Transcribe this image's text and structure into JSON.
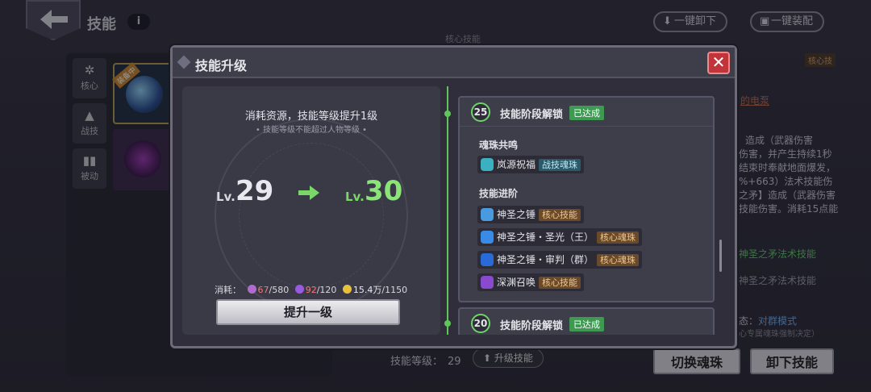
{
  "background": {
    "page_title": "技能",
    "info_label": "i",
    "top_buttons": [
      {
        "icon": "download-icon",
        "label": "一键卸下"
      },
      {
        "icon": "equip-icon",
        "label": "一键装配"
      }
    ],
    "tabs": [
      {
        "icon": "core-icon",
        "label": "核心"
      },
      {
        "icon": "combat-icon",
        "label": "战技"
      },
      {
        "icon": "passive-icon",
        "label": "被动"
      }
    ],
    "slot_badge": "装备中",
    "header_text": "核心技能",
    "core_tag": "核心技",
    "skill_link": "的电泵",
    "desc_lines": [
      "造成（武器伤害",
      "伤害，并产生持续1秒",
      "结束时奉献地面爆发，",
      "%+663）法术技能伤",
      "之矛】造成（武器伤害",
      "技能伤害。消耗15点能"
    ],
    "green_text": "神圣之矛法术技能",
    "gray_text": "神圣之矛法术技能",
    "mode_prefix": "态：",
    "mode_value": "对群模式",
    "mode_note": "心专属魂珠强制决定）",
    "skill_level_label": "技能等级：",
    "skill_level_value": "29",
    "upgrade_skill_label": "升级技能",
    "switch_orb_label": "切换魂珠",
    "unequip_label": "卸下技能"
  },
  "modal": {
    "title": "技能升级",
    "close_label": "✕",
    "cost_title": "消耗资源，技能等级提升1级",
    "cost_subtitle": "• 技能等级不能超过人物等级 •",
    "lv_prefix": "Lv.",
    "from_level": "29",
    "to_level": "30",
    "cost_label": "消耗：",
    "resources": [
      {
        "icon": "soul-shard-icon",
        "have": "67",
        "need": "/580",
        "color": "#b06ad0"
      },
      {
        "icon": "purple-crystal-icon",
        "have": "92",
        "need": "/120",
        "color": "#9a5ae0"
      },
      {
        "icon": "gold-coin-icon",
        "have": "15.4万",
        "need": "/1150",
        "color": "#e8c03a"
      }
    ],
    "upgrade_button": "提升一级",
    "stages": [
      {
        "level": "25",
        "title": "技能阶段解锁",
        "status": "已达成",
        "sections": [
          {
            "label": "魂珠共鸣",
            "skills": [
              {
                "name": "岚源祝福",
                "tag": "战技魂珠",
                "tag_type": "combat",
                "icon_color": "#3ab0c0"
              }
            ]
          },
          {
            "label": "技能进阶",
            "skills": [
              {
                "name": "神圣之锤",
                "tag": "核心技能",
                "tag_type": "core",
                "icon_color": "#4a9ae0"
              },
              {
                "name": "神圣之锤・圣光（王）",
                "tag": "核心魂珠",
                "tag_type": "core",
                "icon_color": "#3a8ae8"
              },
              {
                "name": "神圣之锤・审判（群）",
                "tag": "核心魂珠",
                "tag_type": "core",
                "icon_color": "#2a6ad8"
              },
              {
                "name": "深渊召唤",
                "tag": "核心技能",
                "tag_type": "core",
                "icon_color": "#8a4ad0"
              }
            ]
          }
        ]
      },
      {
        "level": "20",
        "title": "技能阶段解锁",
        "status": "已达成"
      }
    ]
  }
}
